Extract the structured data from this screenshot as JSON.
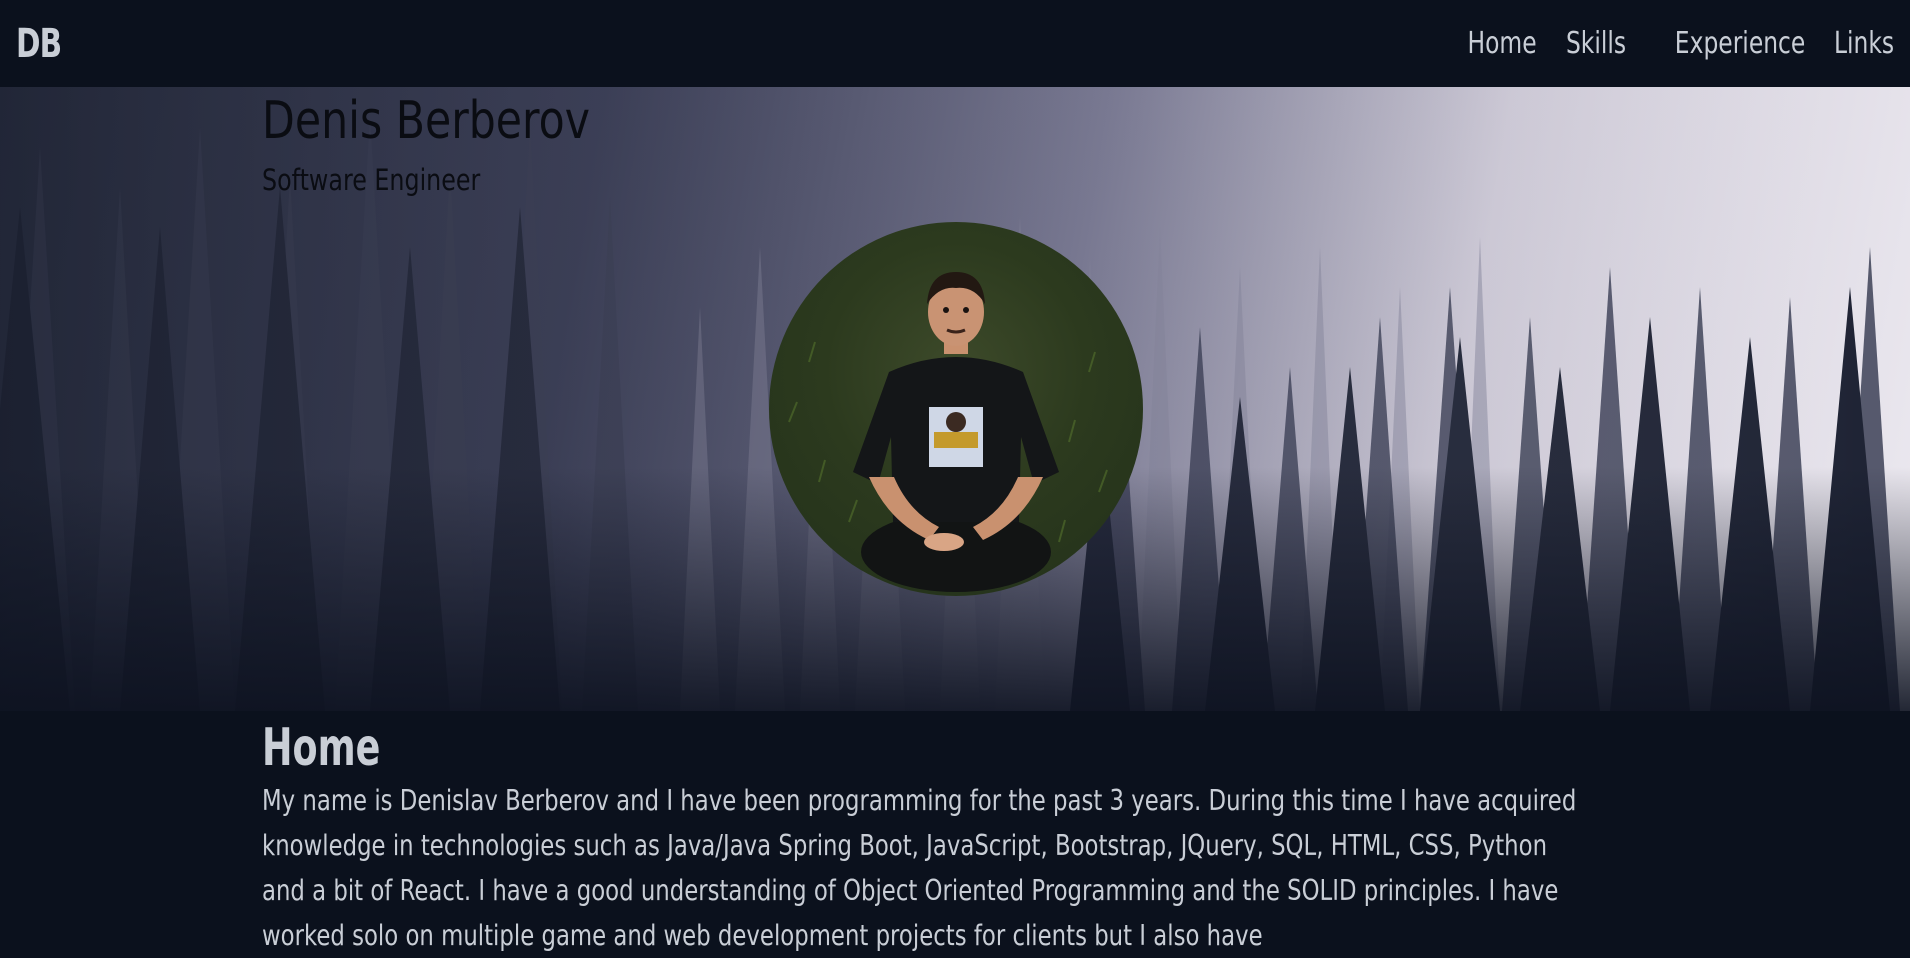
{
  "navbar": {
    "brand": "DB",
    "links": [
      "Home",
      "Skills",
      "Experience",
      "Links"
    ]
  },
  "hero": {
    "title": "Denis Berberov",
    "subtitle": "Software Engineer",
    "avatar_icon": "profile-photo"
  },
  "home": {
    "heading": "Home",
    "paragraph": "My name is Denislav Berberov and I have been programming for the past 3 years. During this time I have acquired knowledge in technologies such as Java/Java Spring Boot, JavaScript, Bootstrap, JQuery, SQL, HTML, CSS, Python and a bit of React. I have a good understanding of Object Oriented Programming and the SOLID principles. I have worked solo on multiple game and web development projects for clients but I also have"
  },
  "colors": {
    "background": "#0b111d",
    "text": "#c9ced6",
    "hero_text": "#0a0c12"
  }
}
